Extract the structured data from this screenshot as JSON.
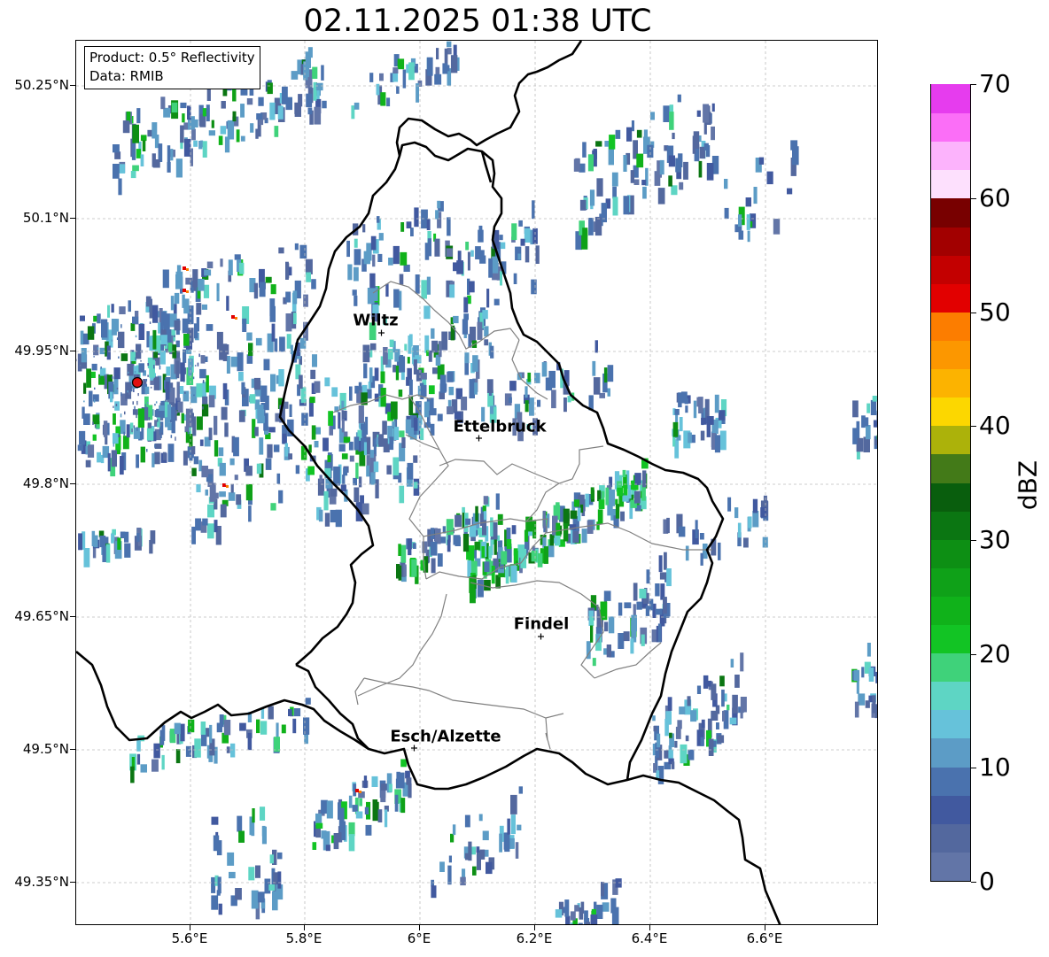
{
  "title": "02.11.2025 01:38 UTC",
  "info": {
    "product": "Product: 0.5° Reflectivity",
    "data": "Data: RMIB"
  },
  "lat_ticks": [
    "50.25°N",
    "50.1°N",
    "49.95°N",
    "49.8°N",
    "49.65°N",
    "49.5°N",
    "49.35°N"
  ],
  "lon_ticks": [
    "5.6°E",
    "5.8°E",
    "6°E",
    "6.2°E",
    "6.4°E",
    "6.6°E"
  ],
  "cities": [
    {
      "name": "Wiltz",
      "marker": false
    },
    {
      "name": "Ettelbruck",
      "marker": true
    },
    {
      "name": "Findel",
      "marker": true
    },
    {
      "name": "Esch/Alzette",
      "marker": true
    }
  ],
  "colorbar": {
    "label": "dBZ",
    "ticks": [
      "0",
      "10",
      "20",
      "30",
      "40",
      "50",
      "60",
      "70"
    ],
    "min": 0,
    "max": 70,
    "step": 2.5,
    "colors": [
      "#6275a7",
      "#53689e",
      "#41599f",
      "#4a72ae",
      "#5c9cc6",
      "#66c2da",
      "#5ed5c4",
      "#3fd27a",
      "#12c424",
      "#10b21a",
      "#0fa118",
      "#0d8f14",
      "#0b7612",
      "#095e0d",
      "#437a18",
      "#acb20a",
      "#fcd700",
      "#fcb300",
      "#fc9700",
      "#fc7d00",
      "#e20000",
      "#c30000",
      "#a20000",
      "#780000",
      "#fde0fd",
      "#fcb3fc",
      "#fb6ef7",
      "#e63cee"
    ]
  },
  "style": {
    "border_color": "#000000",
    "district_color": "#808080",
    "grid_color": "#bdbdbd",
    "radar_site_color": "#e01010"
  }
}
